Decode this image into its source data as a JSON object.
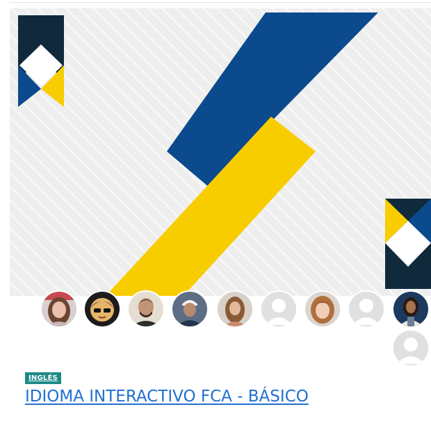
{
  "course": {
    "category": "INGLÉS",
    "title": "IDIOMA INTERACTIVO FCA - BÁSICO"
  },
  "banner": {
    "colors": {
      "navy": "#0b4a8c",
      "yellow": "#f8cd00",
      "dark": "#102a3c",
      "background": "#ececec"
    }
  },
  "participants": [
    {
      "name": "participant-1",
      "kind": "photo"
    },
    {
      "name": "participant-2",
      "kind": "photo"
    },
    {
      "name": "participant-3",
      "kind": "photo"
    },
    {
      "name": "participant-4",
      "kind": "photo"
    },
    {
      "name": "participant-5",
      "kind": "photo"
    },
    {
      "name": "participant-6",
      "kind": "default-user-icon"
    },
    {
      "name": "participant-7",
      "kind": "photo"
    },
    {
      "name": "participant-8",
      "kind": "default-user-icon"
    },
    {
      "name": "participant-9",
      "kind": "photo"
    },
    {
      "name": "participant-10",
      "kind": "default-user-icon"
    }
  ]
}
